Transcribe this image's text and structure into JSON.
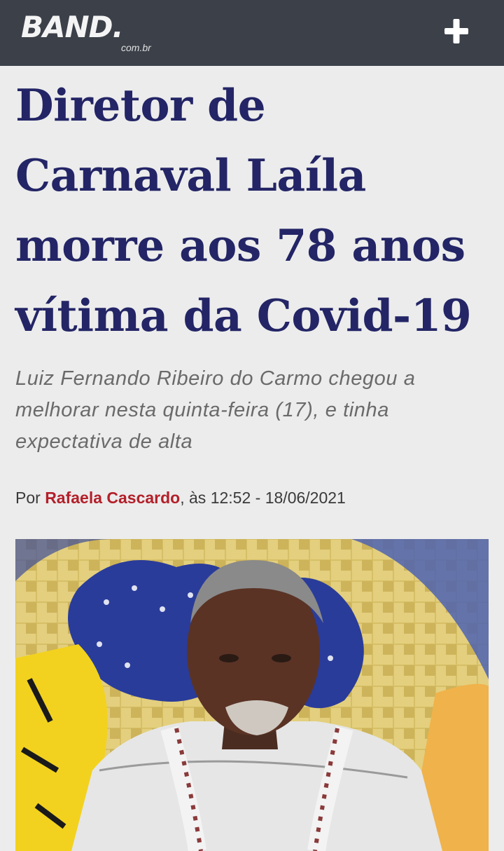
{
  "header": {
    "logo_text": "BAND.",
    "logo_sub": "com.br",
    "menu_icon": "plus-icon",
    "background_color": "#3b4049"
  },
  "article": {
    "headline": "Diretor de Carnaval Laíla morre aos 78 anos vítima da Covid-19",
    "summary": "Luiz Fernando Ribeiro do Carmo chegou a melhorar nesta quinta-feira (17), e tinha expectativa de alta",
    "byline": {
      "prefix": "Por",
      "author": "Rafaela Cascardo",
      "separator": ", às",
      "time": "12:52",
      "dash": "-",
      "date": "18/06/2021"
    },
    "headline_color": "#232566",
    "author_color": "#b3202a"
  }
}
